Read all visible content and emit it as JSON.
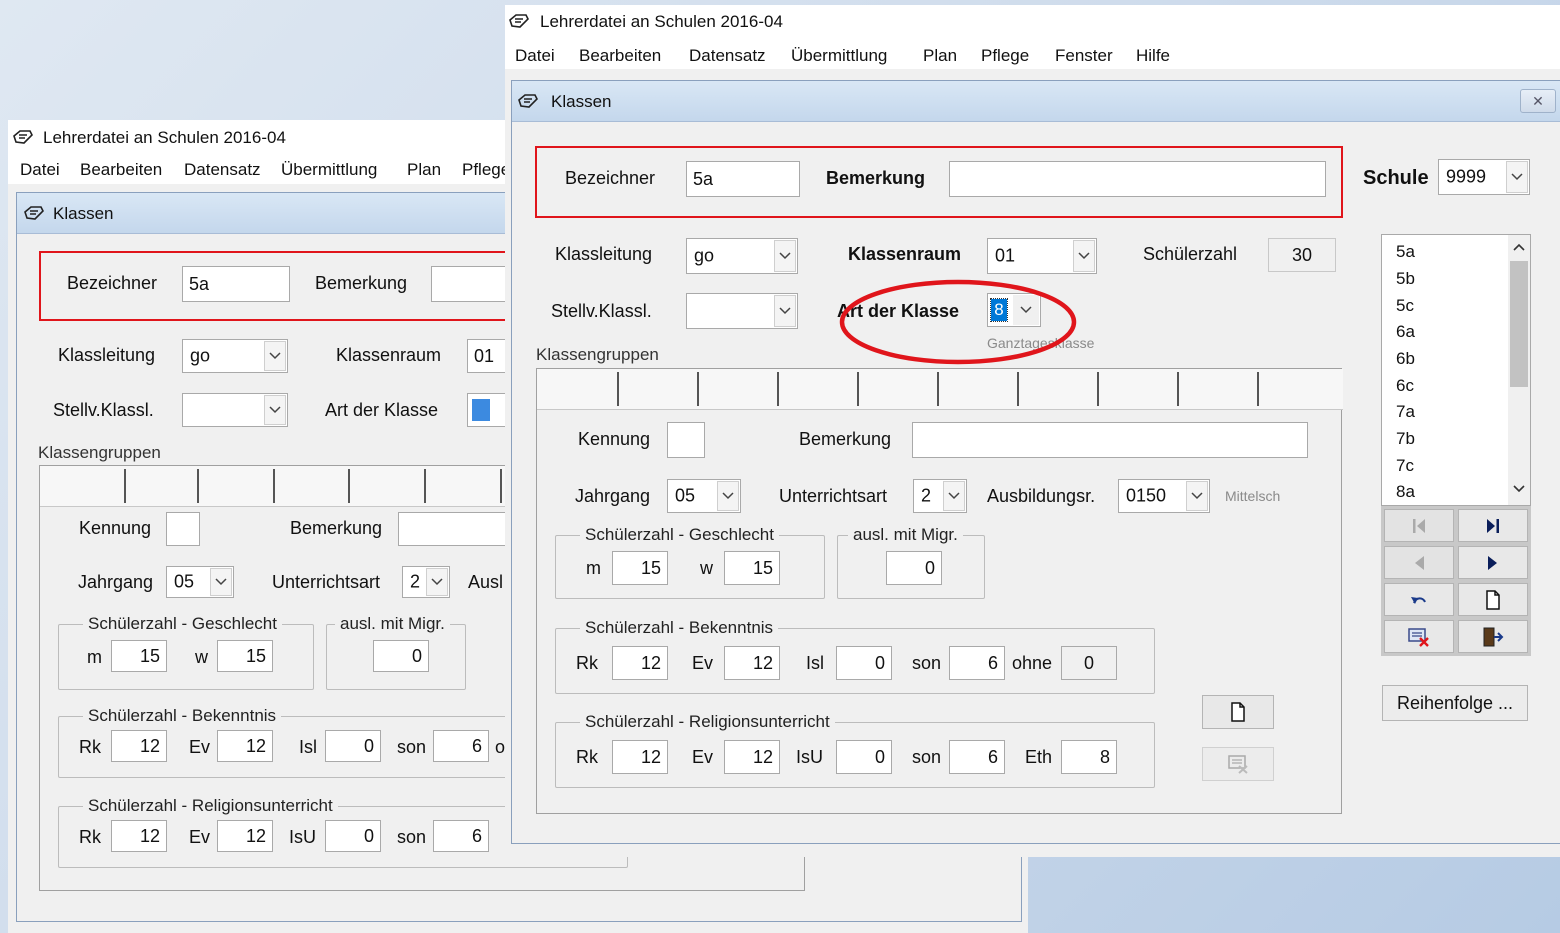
{
  "app": {
    "title": "Lehrerdatei an Schulen 2016-04",
    "menu": [
      "Datei",
      "Bearbeiten",
      "Datensatz",
      "Übermittlung",
      "Plan",
      "Pflege",
      "Fenster",
      "Hilfe"
    ],
    "back_menu": [
      "Datei",
      "Bearbeiten",
      "Datensatz",
      "Übermittlung",
      "Plan",
      "Pflege"
    ]
  },
  "dialog": {
    "title": "Klassen",
    "close_glyph": "✕"
  },
  "labels": {
    "bezeichner": "Bezeichner",
    "bemerkung": "Bemerkung",
    "schule": "Schule",
    "klassleitung": "Klassleitung",
    "klassenraum": "Klassenraum",
    "schuelerzahl": "Schülerzahl",
    "stellv": "Stellv.Klassl.",
    "art": "Art der Klasse",
    "art_hint": "Ganztagesklasse",
    "klassengruppen": "Klassengruppen",
    "kennung": "Kennung",
    "bemerkung2": "Bemerkung",
    "jahrgang": "Jahrgang",
    "unterrichtsart": "Unterrichtsart",
    "ausbildungsr": "Ausbildungsr.",
    "ausbildungsr_hint": "Mittelsch",
    "ausl_front": "Ausl",
    "g_geschlecht": "Schülerzahl - Geschlecht",
    "g_migr": "ausl. mit Migr.",
    "g_bekenntnis": "Schülerzahl - Bekenntnis",
    "g_religion": "Schülerzahl - Religionsunterricht",
    "m": "m",
    "w": "w",
    "rk": "Rk",
    "ev": "Ev",
    "isl": "Isl",
    "son": "son",
    "ohne": "ohne",
    "ohne_cut": "o",
    "isu": "IsU",
    "eth": "Eth",
    "reihenfolge": "Reihenfolge ..."
  },
  "values": {
    "bezeichner": "5a",
    "bemerkung": "",
    "schule": "9999",
    "klassleitung": "go",
    "klassenraum": "01",
    "schuelerzahl": "30",
    "stellv": "",
    "art": "8",
    "kennung": "",
    "bemerkung2": "",
    "jahrgang": "05",
    "unterrichtsart": "2",
    "ausbildungsr": "0150",
    "m": "15",
    "w": "15",
    "migr": "0",
    "bek_rk": "12",
    "bek_ev": "12",
    "bek_isl": "0",
    "bek_son": "6",
    "bek_ohne": "0",
    "rel_rk": "12",
    "rel_ev": "12",
    "rel_isu": "0",
    "rel_son": "6",
    "rel_eth": "8"
  },
  "class_list": [
    "5a",
    "5b",
    "5c",
    "6a",
    "6b",
    "6c",
    "7a",
    "7b",
    "7c",
    "8a"
  ],
  "colors": {
    "highlight": "#e0151b",
    "selection": "#0078d7"
  },
  "icons": {
    "nav_first": "first-record-icon",
    "nav_last": "last-record-icon",
    "nav_prev": "previous-record-icon",
    "nav_next": "next-record-icon",
    "undo": "undo-icon",
    "new": "new-document-icon",
    "delete": "delete-record-icon",
    "exit": "exit-door-icon"
  }
}
